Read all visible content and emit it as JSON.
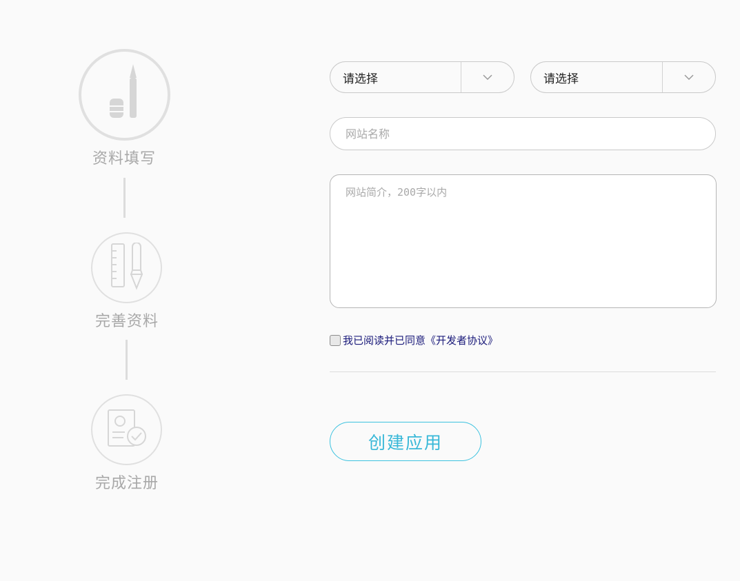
{
  "steps": [
    {
      "label": "资料填写",
      "icon": "pencil-icon"
    },
    {
      "label": "完善资料",
      "icon": "ruler-pen-icon"
    },
    {
      "label": "完成注册",
      "icon": "document-check-icon"
    }
  ],
  "form": {
    "select_1": {
      "value": "请选择"
    },
    "select_2": {
      "value": "请选择"
    },
    "site_name": {
      "placeholder": "网站名称",
      "value": ""
    },
    "site_intro": {
      "placeholder": "网站简介，200字以内",
      "value": ""
    },
    "agreement": {
      "text": "我已阅读并已同意",
      "link": "《开发者协议》",
      "checked": false
    },
    "submit_label": "创建应用"
  },
  "colors": {
    "accent": "#38b8d8",
    "step_gray": "#a8a8a8",
    "agreement_text": "#1a1a7a"
  }
}
